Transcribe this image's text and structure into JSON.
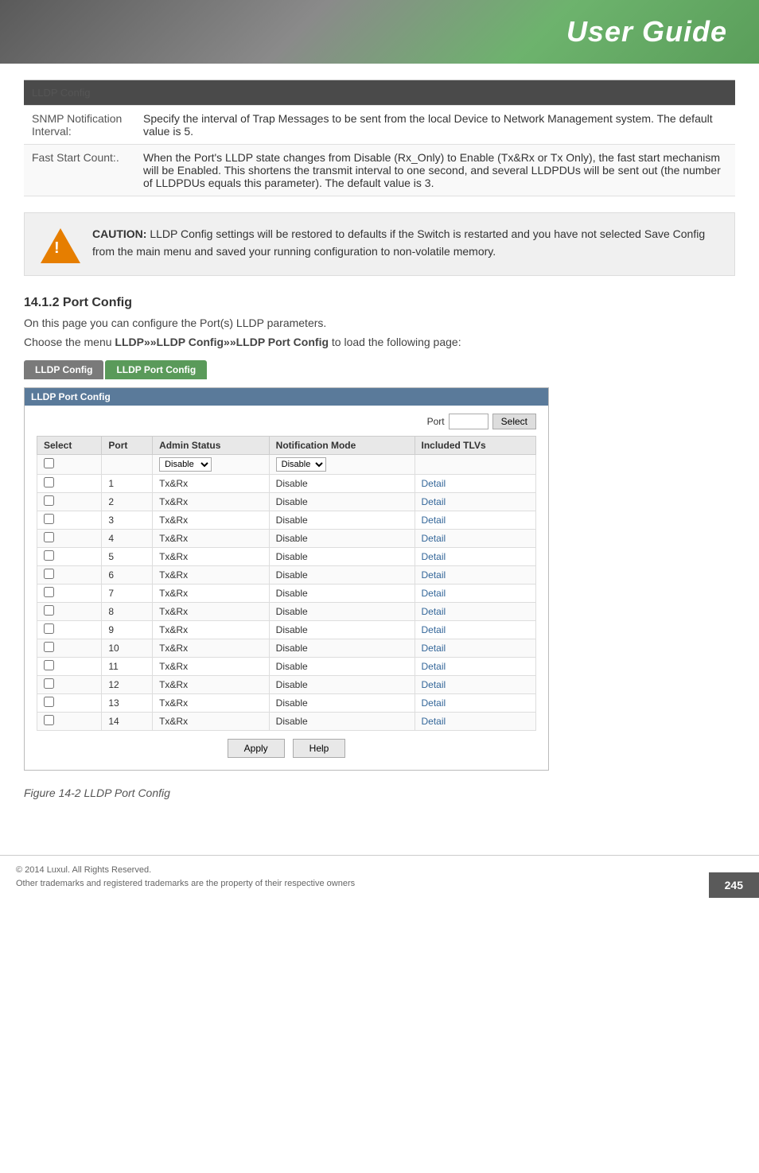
{
  "header": {
    "title": "User Guide"
  },
  "lldp_config": {
    "section_title": "LLDP Config",
    "rows": [
      {
        "label": "SNMP Notification Interval:",
        "description": "Specify the interval of Trap Messages to be sent from the local Device to Network Management system. The default value is 5."
      },
      {
        "label": "Fast Start Count:.",
        "description": "When the Port's LLDP state changes from Disable (Rx_Only) to Enable (Tx&Rx or Tx Only), the fast start mechanism will be Enabled. This shortens the transmit interval to one second, and several LLDPDUs will be sent out (the number of LLDPDUs equals this parameter). The default value is 3."
      }
    ]
  },
  "caution": {
    "label": "CAUTION:",
    "text": " LLDP Config settings will be restored to defaults if the Switch is restarted and you have not selected Save Config from the main menu and saved your running configuration to non-volatile memory."
  },
  "section": {
    "heading": "14.1.2 Port Config",
    "para1": "On this page you can configure the Port(s) LLDP parameters.",
    "para2": "Choose the menu LLDP»»LLDP Config»»LLDP Port Config to load the following page:"
  },
  "nav_tabs": [
    {
      "label": "LLDP Config",
      "active": false
    },
    {
      "label": "LLDP Port Config",
      "active": true
    }
  ],
  "port_config": {
    "title": "LLDP Port Config",
    "port_label": "Port",
    "select_btn": "Select",
    "columns": [
      "Select",
      "Port",
      "Admin Status",
      "Notification Mode",
      "Included TLVs"
    ],
    "default_admin": "Disable",
    "default_notification": "Disable",
    "rows": [
      {
        "port": "1",
        "admin": "Tx&Rx",
        "notification": "Disable",
        "tlv": "Detail"
      },
      {
        "port": "2",
        "admin": "Tx&Rx",
        "notification": "Disable",
        "tlv": "Detail"
      },
      {
        "port": "3",
        "admin": "Tx&Rx",
        "notification": "Disable",
        "tlv": "Detail"
      },
      {
        "port": "4",
        "admin": "Tx&Rx",
        "notification": "Disable",
        "tlv": "Detail"
      },
      {
        "port": "5",
        "admin": "Tx&Rx",
        "notification": "Disable",
        "tlv": "Detail"
      },
      {
        "port": "6",
        "admin": "Tx&Rx",
        "notification": "Disable",
        "tlv": "Detail"
      },
      {
        "port": "7",
        "admin": "Tx&Rx",
        "notification": "Disable",
        "tlv": "Detail"
      },
      {
        "port": "8",
        "admin": "Tx&Rx",
        "notification": "Disable",
        "tlv": "Detail"
      },
      {
        "port": "9",
        "admin": "Tx&Rx",
        "notification": "Disable",
        "tlv": "Detail"
      },
      {
        "port": "10",
        "admin": "Tx&Rx",
        "notification": "Disable",
        "tlv": "Detail"
      },
      {
        "port": "11",
        "admin": "Tx&Rx",
        "notification": "Disable",
        "tlv": "Detail"
      },
      {
        "port": "12",
        "admin": "Tx&Rx",
        "notification": "Disable",
        "tlv": "Detail"
      },
      {
        "port": "13",
        "admin": "Tx&Rx",
        "notification": "Disable",
        "tlv": "Detail"
      },
      {
        "port": "14",
        "admin": "Tx&Rx",
        "notification": "Disable",
        "tlv": "Detail"
      }
    ],
    "apply_btn": "Apply",
    "help_btn": "Help"
  },
  "figure_caption": "Figure 14-2 LLDP Port Config",
  "footer": {
    "copyright": "© 2014  Luxul. All Rights Reserved.",
    "trademark": "Other trademarks and registered trademarks are the property of their respective owners",
    "page": "245"
  }
}
